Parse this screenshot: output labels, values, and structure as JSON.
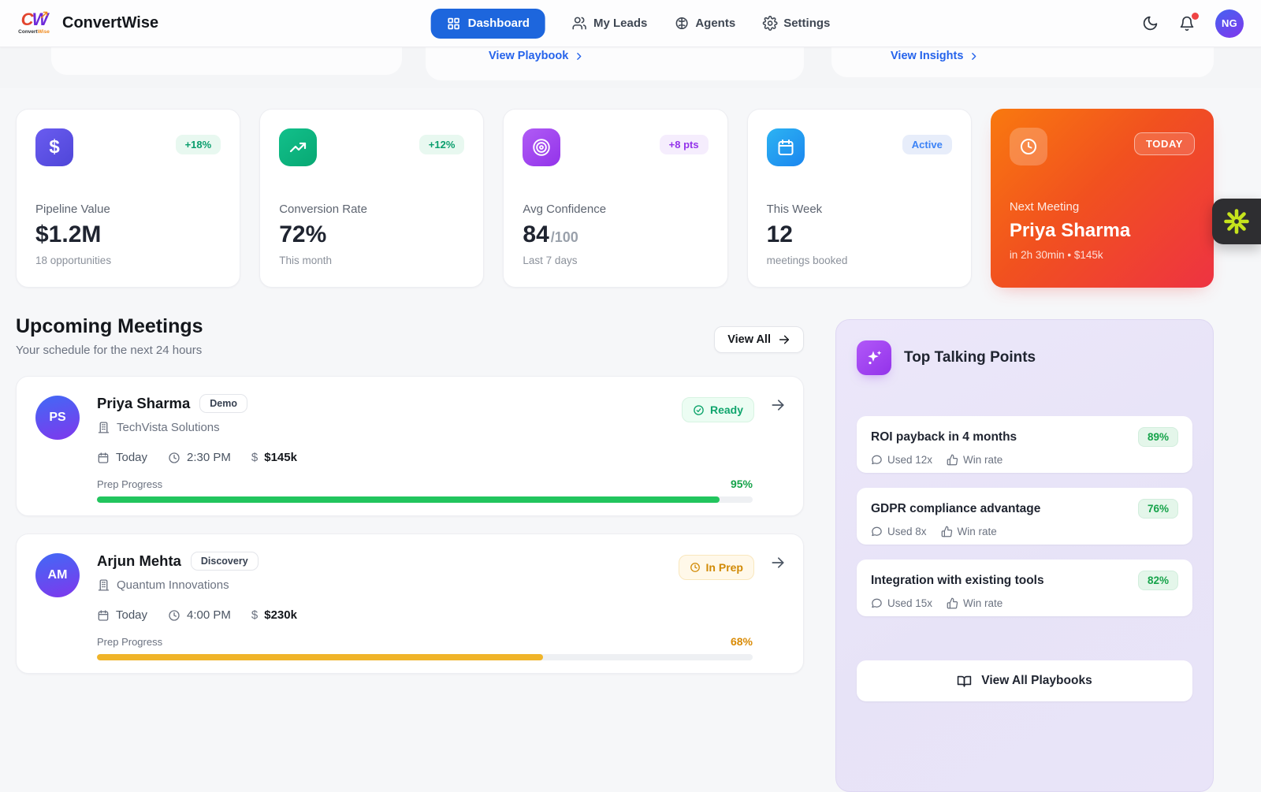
{
  "brand": {
    "title": "ConvertWise",
    "logo_letters_c": "C",
    "logo_letters_w": "W",
    "logo_caption_a": "Convert",
    "logo_caption_b": "Wise"
  },
  "header": {
    "nav": [
      {
        "label": "Dashboard",
        "icon": "grid-icon",
        "active": true
      },
      {
        "label": "My Leads",
        "icon": "users-icon",
        "active": false
      },
      {
        "label": "Agents",
        "icon": "brain-icon",
        "active": false
      },
      {
        "label": "Settings",
        "icon": "gear-icon",
        "active": false
      }
    ],
    "avatar_initials": "NG",
    "has_notification_dot": true
  },
  "peek_links": {
    "playbook": "View Playbook",
    "insights": "View Insights"
  },
  "icons": {
    "dollar_glyph": "$"
  },
  "stats": [
    {
      "label": "Pipeline Value",
      "value": "$1.2M",
      "sub": "18 opportunities",
      "badge": "+18%",
      "icon": "dollar-icon"
    },
    {
      "label": "Conversion Rate",
      "value": "72%",
      "sub": "This month",
      "badge": "+12%",
      "icon": "trend-up-icon"
    },
    {
      "label": "Avg Confidence",
      "value": "84",
      "value_suffix": "/100",
      "sub": "Last 7 days",
      "badge": "+8 pts",
      "icon": "target-icon"
    },
    {
      "label": "This Week",
      "value": "12",
      "sub": "meetings booked",
      "badge": "Active",
      "icon": "calendar-icon"
    }
  ],
  "next_meeting": {
    "badge": "TODAY",
    "label": "Next Meeting",
    "name": "Priya Sharma",
    "detail": "in 2h 30min • $145k"
  },
  "meetings_section": {
    "title": "Upcoming Meetings",
    "subtitle": "Your schedule for the next 24 hours",
    "view_all": "View All"
  },
  "meetings": [
    {
      "initials": "PS",
      "name": "Priya Sharma",
      "stage": "Demo",
      "company": "TechVista Solutions",
      "date": "Today",
      "time": "2:30 PM",
      "value": "$145k",
      "status": "Ready",
      "progress_label": "Prep Progress",
      "progress_text": "95%",
      "progress_pct": 95
    },
    {
      "initials": "AM",
      "name": "Arjun Mehta",
      "stage": "Discovery",
      "company": "Quantum Innovations",
      "date": "Today",
      "time": "4:00 PM",
      "value": "$230k",
      "status": "In Prep",
      "progress_label": "Prep Progress",
      "progress_text": "68%",
      "progress_pct": 68
    }
  ],
  "talking_points": {
    "title": "Top Talking Points",
    "items": [
      {
        "text": "ROI payback in 4 months",
        "rate": "89%",
        "used": "Used 12x",
        "win": "Win rate"
      },
      {
        "text": "GDPR compliance advantage",
        "rate": "76%",
        "used": "Used 8x",
        "win": "Win rate"
      },
      {
        "text": "Integration with existing tools",
        "rate": "82%",
        "used": "Used 15x",
        "win": "Win rate"
      }
    ],
    "footer": "View All Playbooks"
  },
  "colors": {
    "primary_blue": "#1d66dd",
    "link_blue": "#2563eb",
    "success_green": "#16a34a",
    "progress_green": "#22c55e",
    "warning_amber": "#d98b06",
    "progress_amber": "#f0b429",
    "stat_indigo": "#5a50e4",
    "stat_green": "#0fae7f",
    "stat_purple": "#a04df0",
    "stat_blue": "#23a0f0",
    "next_meeting_gradient_start": "#f9790f",
    "next_meeting_gradient_end": "#ee3342",
    "widget_lime": "#c6e41c",
    "notification_red": "#ef4444"
  }
}
